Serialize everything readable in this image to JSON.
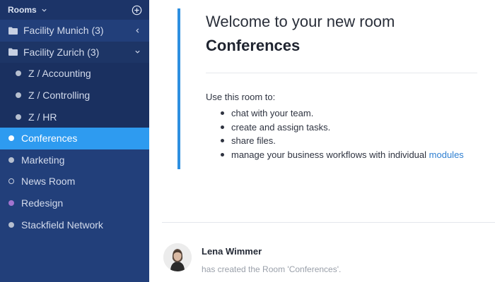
{
  "sidebar": {
    "header": {
      "title": "Rooms"
    },
    "folders": [
      {
        "label": "Facility Munich (3)",
        "state": "collapsed"
      },
      {
        "label": "Facility Zurich (3)",
        "state": "expanded"
      }
    ],
    "subrooms": [
      {
        "label": "Z / Accounting"
      },
      {
        "label": "Z / Controlling"
      },
      {
        "label": "Z / HR"
      }
    ],
    "rooms": [
      {
        "label": "Conferences",
        "active": true
      },
      {
        "label": "Marketing"
      },
      {
        "label": "News Room"
      },
      {
        "label": "Redesign"
      },
      {
        "label": "Stackfield Network"
      }
    ]
  },
  "welcome": {
    "line1": "Welcome to your new room",
    "room_name": "Conferences",
    "intro": "Use this room to:",
    "bullets": [
      "chat with your team.",
      "create and assign tasks.",
      "share files.",
      "manage your business workflows with individual"
    ],
    "modules_link": "modules"
  },
  "activity": {
    "author": "Lena Wimmer",
    "action": "has created the Room 'Conferences'."
  },
  "colors": {
    "sidebar_bg": "#223f7a",
    "active_bg": "#2e9bf0",
    "accent_border": "#2e8fe0",
    "link": "#2e7fd1",
    "redesign_dot": "#a374cf"
  },
  "icons": [
    "chevron-down-icon",
    "add-circle-icon",
    "folder-icon",
    "chevron-left-icon",
    "avatar"
  ]
}
